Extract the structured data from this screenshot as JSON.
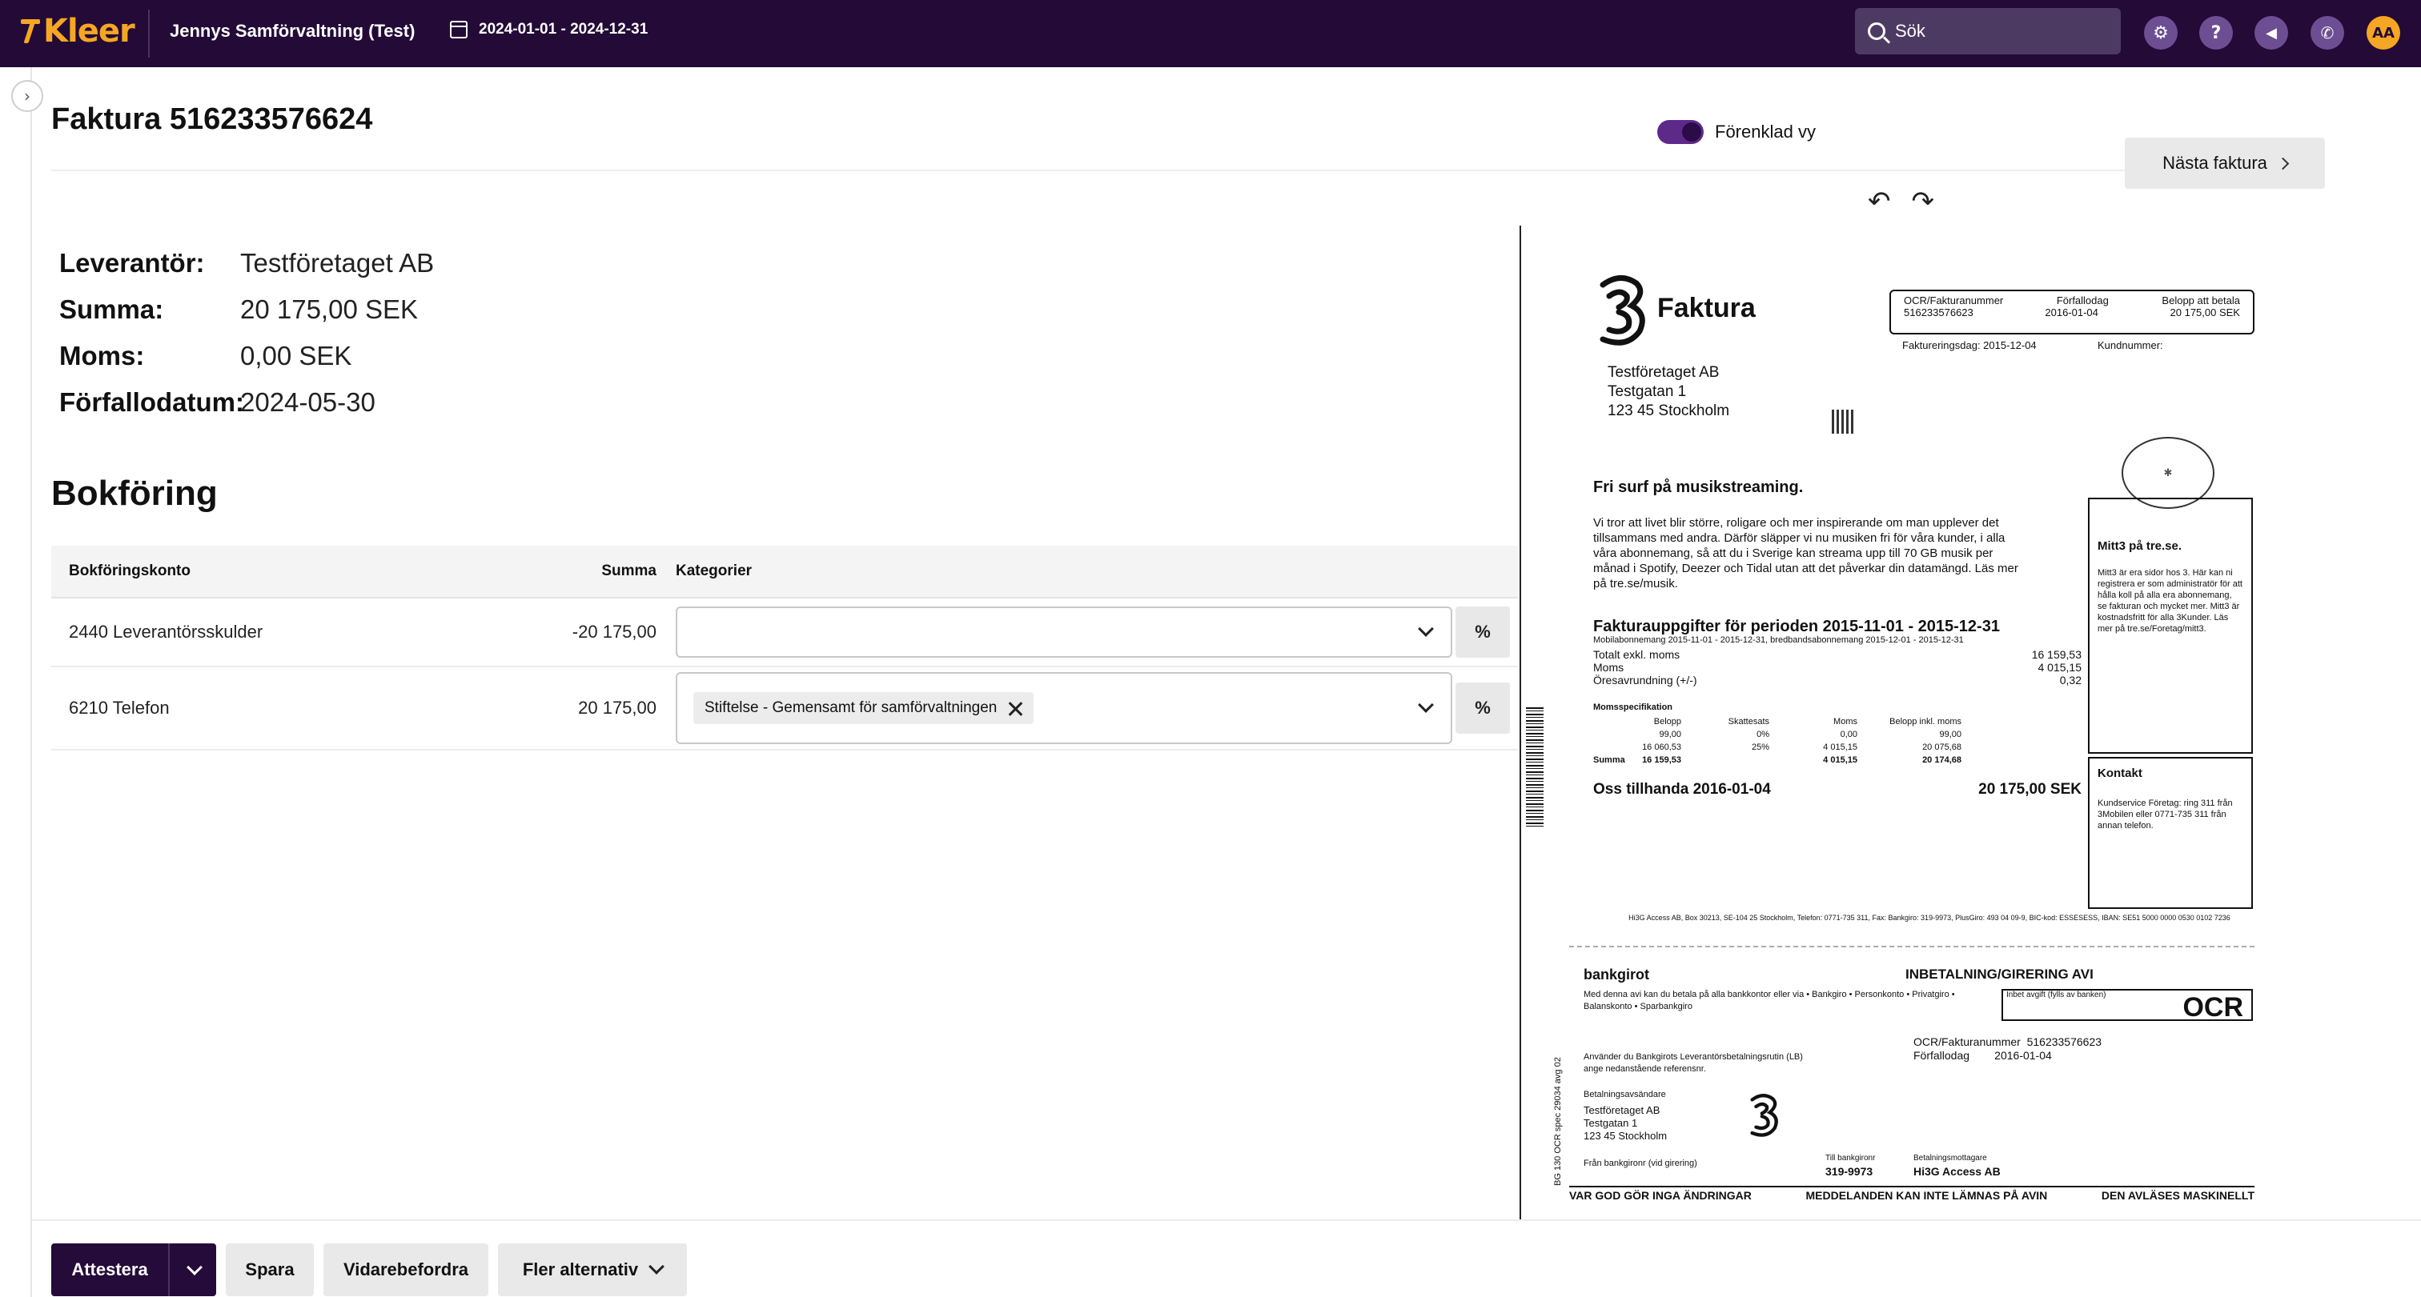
{
  "topbar": {
    "logo": "Kleer",
    "company": "Jennys Samförvaltning (Test)",
    "date_range": "2024-01-01 - 2024-12-31",
    "search_placeholder": "Sök",
    "avatar_initials": "AA",
    "icons": [
      "gear-icon",
      "help-icon",
      "megaphone-icon",
      "phone-icon"
    ]
  },
  "page": {
    "title": "Faktura 516233576624",
    "simplified_view_label": "Förenklad vy",
    "simplified_view_on": true,
    "next_invoice_label": "Nästa faktura"
  },
  "details": {
    "supplier_label": "Leverantör:",
    "supplier_value": "Testföretaget AB",
    "sum_label": "Summa:",
    "sum_value": "20 175,00 SEK",
    "vat_label": "Moms:",
    "vat_value": "0,00 SEK",
    "due_label": "Förfallodatum:",
    "due_value": "2024-05-30"
  },
  "bookkeeping": {
    "title": "Bokföring",
    "headers": {
      "account": "Bokföringskonto",
      "sum": "Summa",
      "categories": "Kategorier"
    },
    "rows": [
      {
        "account": "2440 Leverantörsskulder",
        "sum": "-20 175,00",
        "category_chip": "",
        "percent_label": "%"
      },
      {
        "account": "6210 Telefon",
        "sum": "20 175,00",
        "category_chip": "Stiftelse - Gemensamt för samförvaltningen",
        "percent_label": "%"
      }
    ]
  },
  "document": {
    "brand_title": "Faktura",
    "ocr_label": "OCR/Fakturanummer",
    "ocr_value": "516233576623",
    "due_label": "Förfallodag",
    "due_value": "2016-01-04",
    "amount_label": "Belopp att betala",
    "amount_value": "20 175,00 SEK",
    "invoice_date": "Faktureringsdag: 2015-12-04",
    "customer_no": "Kundnummer:",
    "address": [
      "Testföretaget AB",
      "Testgatan 1",
      "123 45 Stockholm"
    ],
    "promo_title": "Fri surf på musikstreaming.",
    "promo_text": "Vi tror att livet blir större, roligare och mer inspirerande om man upplever det tillsammans med andra. Därför släpper vi nu musiken fri för våra kunder, i alla våra abonnemang, så att du i Sverige kan streama upp till 70 GB musik per månad i Spotify, Deezer och Tidal utan att det påverkar din datamängd. Läs mer på tre.se/musik.",
    "period_title": "Fakturauppgifter för perioden 2015-11-01 - 2015-12-31",
    "period_line": "Mobilabonnemang 2015-11-01 - 2015-12-31, bredbandsabonnemang 2015-12-01 - 2015-12-31",
    "amount_rows": [
      {
        "label": "Totalt exkl. moms",
        "value": "16 159,53"
      },
      {
        "label": "Moms",
        "value": "4 015,15"
      },
      {
        "label": "Öresavrundning (+/-)",
        "value": "0,32"
      }
    ],
    "vat_spec_title": "Momsspecifikation",
    "vat_headers": [
      "Belopp",
      "Skattesats",
      "Moms",
      "Belopp inkl. moms"
    ],
    "vat_rows": [
      [
        "99,00",
        "0%",
        "0,00",
        "99,00"
      ],
      [
        "16 060,53",
        "25%",
        "4 015,15",
        "20 075,68"
      ]
    ],
    "vat_sum": [
      "Summa",
      "16 159,53",
      "4 015,15",
      "20 174,68"
    ],
    "due_line_label": "Oss tillhanda 2016-01-04",
    "due_line_value": "20 175,00 SEK",
    "mitt3_title": "Mitt3 på tre.se.",
    "mitt3_text": "Mitt3 är era sidor hos 3. Här kan ni registrera er som administratör för att hålla koll på alla era abonnemang, se fakturan och mycket mer. Mitt3 är kostnadsfritt för alla 3Kunder. Läs mer på tre.se/Foretag/mitt3.",
    "contact_title": "Kontakt",
    "contact_text": "Kundservice Företag: ring 311 från 3Mobilen eller 0771-735 311 från annan telefon.",
    "footer": "Hi3G Access AB, Box 30213, SE-104 25 Stockholm, Telefon: 0771-735 311, Fax: Bankgiro: 319-9973, PlusGiro: 493 04 09-9, BIC-kod: ESSESESS, IBAN: SE51 5000 0000 0530 0102 7236",
    "avi": {
      "bankgirot": "bankgirot",
      "title": "INBETALNING/GIRERING  AVI",
      "ocr": "OCR",
      "fee_note": "Inbet avgift (fylls av banken)",
      "text": "Med denna avi kan du betala på alla bankkontor eller via • Bankgiro • Personkonto • Privatgiro • Balanskonto • Sparbankgiro",
      "lb_text": "Använder du Bankgirots Leverantörsbetalningsrutin (LB) ange nedanstående referensnr.",
      "sender_label": "Betalningsavsändare",
      "sender": [
        "Testföretaget AB",
        "Testgatan 1",
        "123 45 Stockholm"
      ],
      "ocr_label": "OCR/Fakturanummer",
      "ocr_value": "516233576623",
      "due_label": "Förfallodag",
      "due_value": "2016-01-04",
      "from_bankgiro": "Från bankgironr (vid girering)",
      "to_bankgiro_label": "Till bankgironr",
      "to_bankgiro": "319-9973",
      "recipient_label": "Betalningsmottagare",
      "recipient": "Hi3G Access AB",
      "foot": [
        "VAR GOD GÖR INGA ÄNDRINGAR",
        "MEDDELANDEN KAN INTE LÄMNAS PÅ AVIN",
        "DEN AVLÄSES MASKINELLT"
      ],
      "vertical": "BG 130 OCR spec 29034 avg 02"
    }
  },
  "bottom": {
    "attest_label": "Attestera",
    "save_label": "Spara",
    "forward_label": "Vidarebefordra",
    "more_label": "Fler alternativ"
  }
}
